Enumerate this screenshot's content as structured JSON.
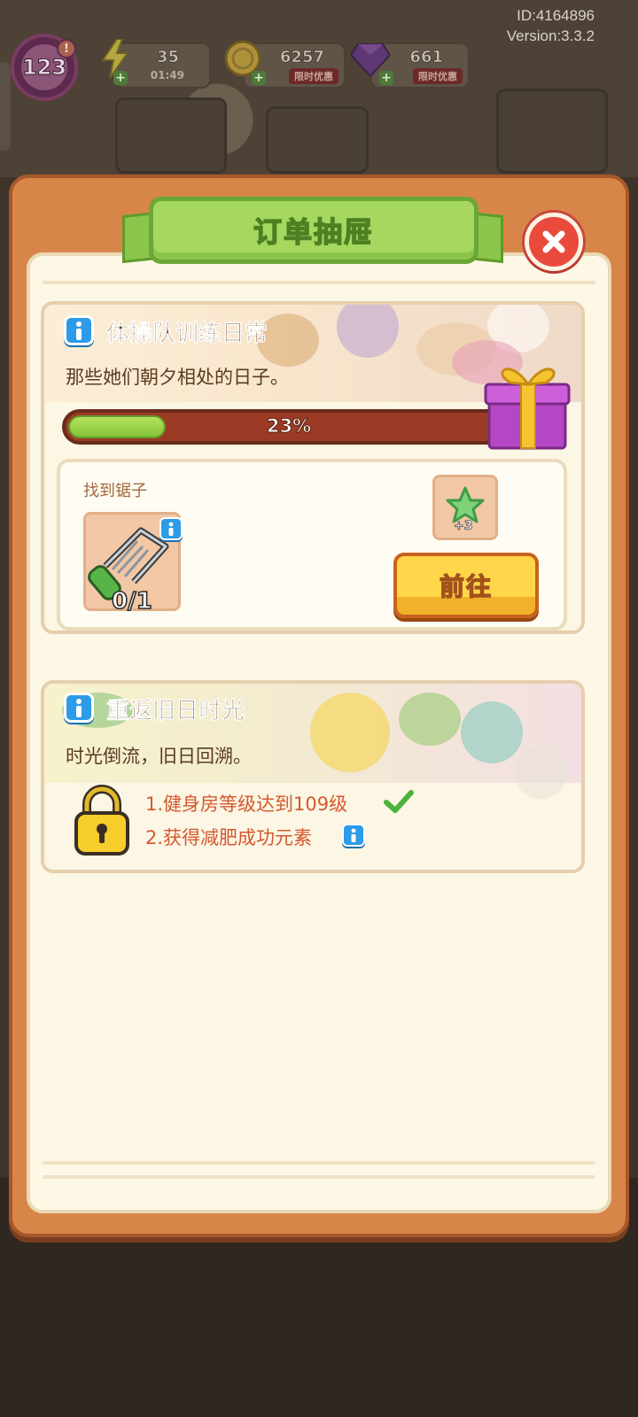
{
  "meta": {
    "id_text": "ID:4164896",
    "version_text": "Version:3.3.2"
  },
  "hud": {
    "level": "123",
    "level_badge": "!",
    "energy": {
      "value": "35",
      "timer": "01:49"
    },
    "coins": {
      "value": "6257",
      "tag": "限时优惠"
    },
    "gems": {
      "value": "661",
      "tag": "限时优惠"
    },
    "plus": "+"
  },
  "modal": {
    "title": "订单抽屉",
    "close_icon": "close-icon"
  },
  "task1": {
    "title": "体操队训练日常",
    "description": "那些她们朝夕相处的日子。",
    "progress_percent": 23,
    "progress_label": "23%",
    "requirement_label": "找到锯子",
    "item_icon": "saw-icon",
    "item_count": "0/1",
    "reward_icon": "green-star-icon",
    "reward_amount": "+3",
    "go_button": "前往"
  },
  "task2": {
    "title": "重返旧日时光",
    "description": "时光倒流，旧日回溯。",
    "lock_icon": "padlock-icon",
    "conditions": [
      {
        "text": "1.健身房等级达到109级",
        "done": true
      },
      {
        "text": "2.获得减肥成功元素",
        "done": false
      }
    ]
  },
  "colors": {
    "modal_frame": "#d8854a",
    "ribbon_green": "#a6d860",
    "progress_track": "#9c3b25",
    "progress_fill": "#84c43a",
    "go_button": "#ffd649",
    "condition_text": "#d4582f",
    "check_green": "#4bb33a",
    "info_blue": "#2e9be8",
    "close_red": "#e94a3c"
  }
}
